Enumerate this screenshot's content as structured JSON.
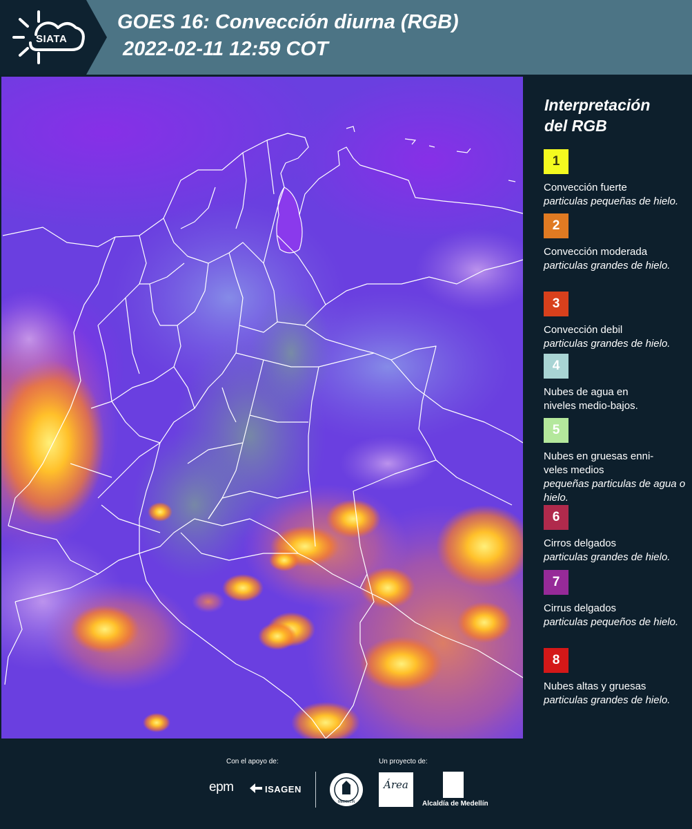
{
  "header": {
    "logo_text": "SIATA",
    "title_line1": "GOES 16: Convección diurna (RGB)",
    "title_line2": "2022-02-11 12:59 COT",
    "background_color": "#4c7485",
    "logo_background": "#0e2230"
  },
  "legend": {
    "title_line1": "Interpretación",
    "title_line2": "del RGB",
    "items": [
      {
        "number": "1",
        "color": "#f4fa1f",
        "number_color": "#3a3a10",
        "name": "Convección fuerte",
        "desc": "particulas pequeñas de hielo."
      },
      {
        "number": "2",
        "color": "#e07a22",
        "number_color": "#ffffff",
        "name": "Convección moderada",
        "desc": "particulas grandes de hielo."
      },
      {
        "number": "3",
        "color": "#d8401c",
        "number_color": "#ffffff",
        "name": "Convección debil",
        "desc": "particulas grandes de hielo."
      },
      {
        "number": "4",
        "color": "#a8d4d4",
        "number_color": "#ffffff",
        "name": "Nubes de agua en niveles medio-bajos.",
        "desc": ""
      },
      {
        "number": "5",
        "color": "#b4e89c",
        "number_color": "#ffffff",
        "name": "Nubes en gruesas enni-veles medios",
        "desc": "pequeñas particulas de agua o hielo."
      },
      {
        "number": "6",
        "color": "#b02a4c",
        "number_color": "#ffffff",
        "name": "Cirros delgados",
        "desc": "particulas grandes de hielo."
      },
      {
        "number": "7",
        "color": "#962a98",
        "number_color": "#ffffff",
        "name": "Cirrus delgados",
        "desc": "particulas pequeños de hielo."
      },
      {
        "number": "8",
        "color": "#d41818",
        "number_color": "#ffffff",
        "name": "Nubes altas y gruesas",
        "desc": "particulas grandes de hielo."
      }
    ]
  },
  "footer": {
    "support_label": "Con el apoyo de:",
    "project_label": "Un proyecto de:",
    "sponsors": [
      "epm",
      "ISAGEN"
    ],
    "partners": [
      "Área Metropolitana Valle de Aburrá",
      "Alcaldía de Medellín"
    ],
    "seal_text": "MEDELLÍN",
    "area_logo_text": "Área",
    "medellin_label": "Alcaldía de Medellín"
  },
  "map": {
    "background_color": "#6a3fe0",
    "border_color": "#ffffff"
  }
}
